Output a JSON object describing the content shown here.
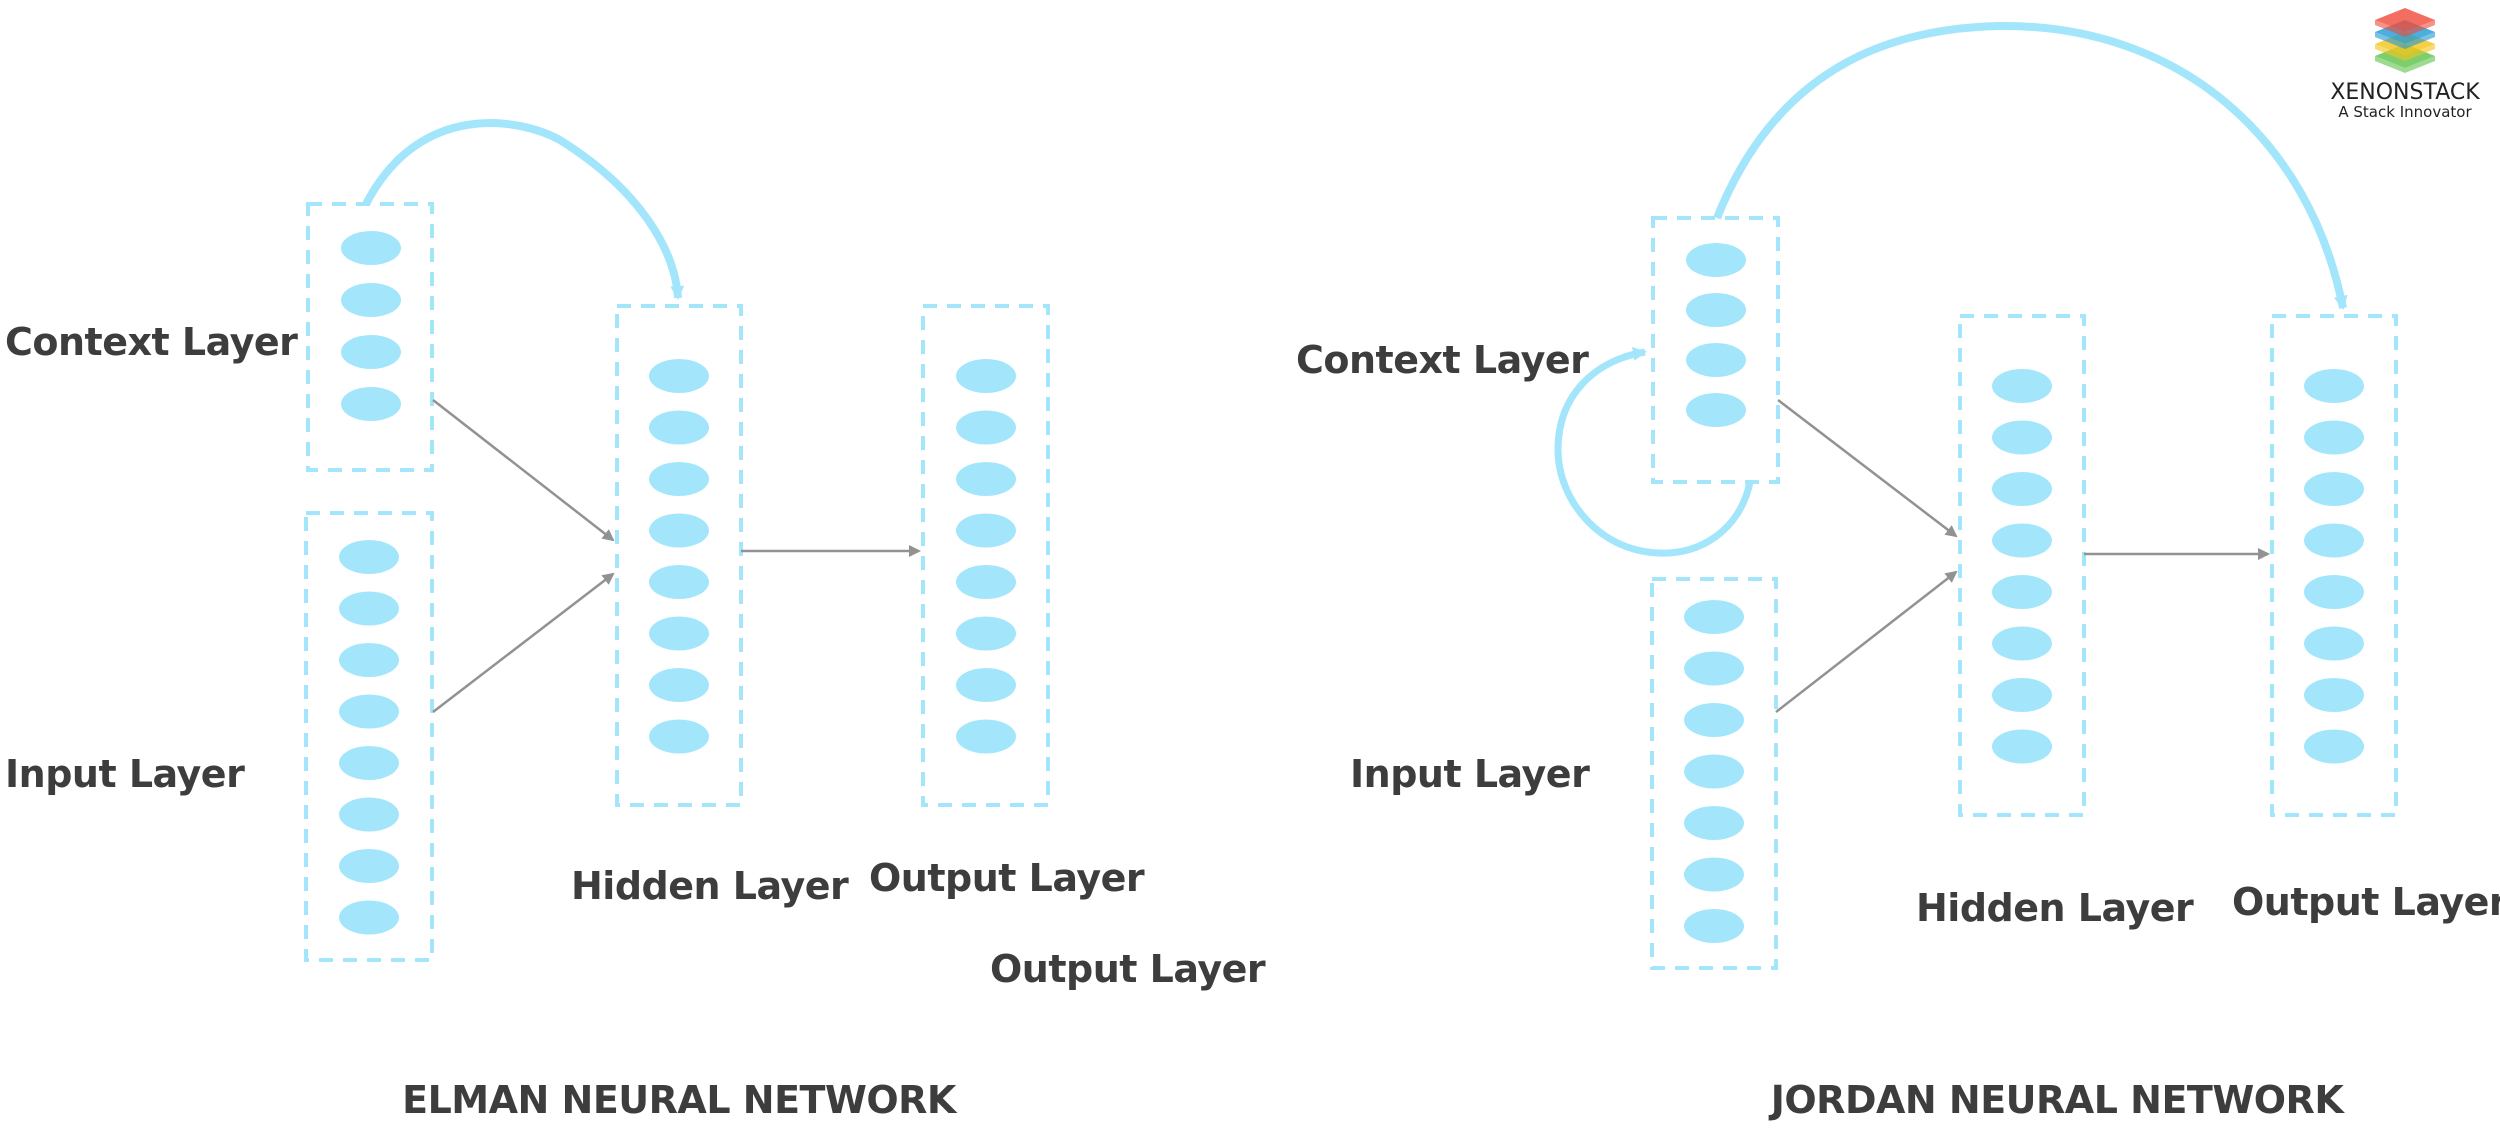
{
  "colors": {
    "node": "#a3e6fc",
    "box_border": "#a3e6fc",
    "recurrent_arrow": "#a3e6fc",
    "connection_arrow": "#929292",
    "text": "#3d3d3d"
  },
  "logo": {
    "brand": "XENONSTACK",
    "tagline": "A Stack Innovator",
    "layer_colors": [
      "#f04a3a",
      "#1f9ad6",
      "#f2c418",
      "#5cc34a"
    ]
  },
  "elman": {
    "title": "ELMAN NEURAL NETWORK",
    "labels": {
      "context": "Context Layer",
      "input": "Input Layer",
      "hidden": "Hidden Layer",
      "output": "Output Layer",
      "output_extra": "Output Layer"
    },
    "layers": {
      "context_nodes": 4,
      "input_nodes": 8,
      "hidden_nodes": 8,
      "output_nodes": 8
    },
    "recurrent_connection": "context-to-hidden"
  },
  "jordan": {
    "title": "JORDAN NEURAL NETWORK",
    "labels": {
      "context": "Context Layer",
      "input": "Input Layer",
      "hidden": "Hidden Layer",
      "output": "Output Layer"
    },
    "layers": {
      "context_nodes": 4,
      "input_nodes": 7,
      "hidden_nodes": 8,
      "output_nodes": 8
    },
    "recurrent_connections": [
      "context-to-output",
      "context-self-loop"
    ]
  }
}
